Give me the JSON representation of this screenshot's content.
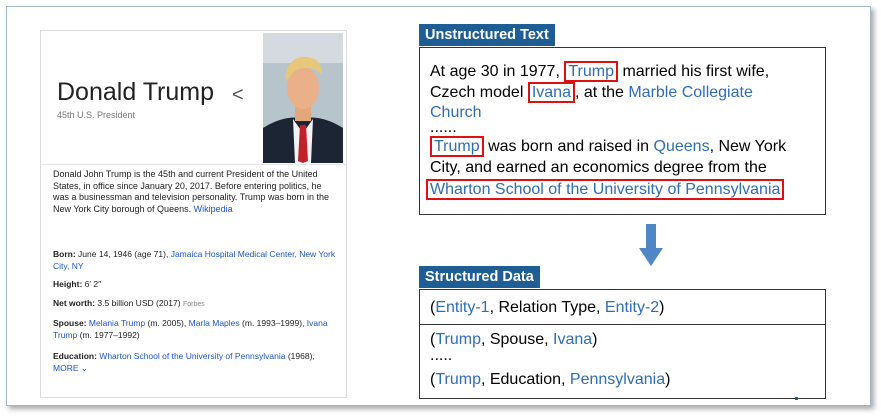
{
  "knowledge_panel": {
    "name": "Donald Trump",
    "subtitle": "45th U.S. President",
    "description": "Donald John Trump is the 45th and current President of the United States, in office since January 20, 2017. Before entering politics, he was a businessman and television personality. Trump was born in the New York City borough of Queens.",
    "wikipedia_link": "Wikipedia",
    "born_label": "Born:",
    "born_value": "June 14, 1946 (age 71),",
    "born_place": "Jamaica Hospital Medical Center, New York City, NY",
    "height_label": "Height:",
    "height_value": "6′ 2″",
    "networth_label": "Net worth:",
    "networth_value": "3.5 billion USD (2017)",
    "networth_source": "Forbes",
    "spouse_label": "Spouse:",
    "spouse_1": "Melania Trump",
    "spouse_1_years": "(m. 2005),",
    "spouse_2": "Marla Maples",
    "spouse_2_years": "(m. 1993–1999),",
    "spouse_3": "Ivana Trump",
    "spouse_3_years": "(m. 1977–1992)",
    "education_label": "Education:",
    "education_value": "Wharton School of the University of Pennsylvania",
    "education_year": "(1968),",
    "more_label": "MORE"
  },
  "unstructured": {
    "title": "Unstructured Text",
    "l1_a": "At age 30 in 1977,",
    "l1_ent": "Trump",
    "l1_b": "married his first wife,",
    "l2_a": "Czech model",
    "l2_ent": "Ivana",
    "l2_b": ", at the",
    "l2_ent2": "Marble Collegiate",
    "l3_ent": "Church",
    "ellipsis": "......",
    "l5_ent": "Trump",
    "l5_a": "was born and raised in",
    "l5_ent2": "Queens",
    "l5_b": ", New York",
    "l6": "City, and earned an economics degree from the",
    "l7_ent": "Wharton School of the University of Pennsylvania"
  },
  "structured": {
    "title": "Structured Data",
    "r1_open": "(",
    "r1_e1": "Entity-1",
    "r1_mid": ", Relation Type,",
    "r1_e2": "Entity-2",
    "r1_close": ")",
    "r2_e1": "Trump",
    "r2_mid": ", Spouse,",
    "r2_e2": "Ivana",
    "dots": ".....",
    "r3_e1": "Trump",
    "r3_mid": ", Education,",
    "r3_e2": "Pennsylvania"
  },
  "colors": {
    "header": "#1f5e94",
    "entity": "#2f6db5",
    "highlight": "#dd1111",
    "link": "#1a56c6"
  },
  "icons": [
    "share-icon",
    "down-arrow-icon",
    "chevron-down-icon"
  ]
}
